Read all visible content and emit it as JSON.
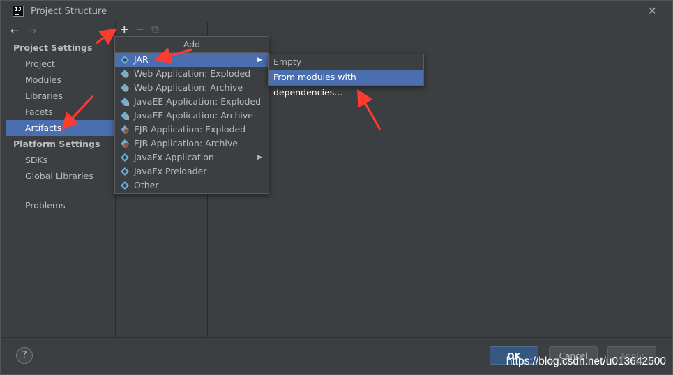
{
  "window": {
    "title": "Project Structure"
  },
  "sidebar": {
    "project_settings": "Project Settings",
    "project_items": [
      "Project",
      "Modules",
      "Libraries",
      "Facets",
      "Artifacts"
    ],
    "platform_settings": "Platform Settings",
    "platform_items": [
      "SDKs",
      "Global Libraries"
    ],
    "problems": "Problems"
  },
  "toolbar": {
    "add": "+",
    "remove": "−",
    "copy": "⧉"
  },
  "add_menu": {
    "header": "Add",
    "items": [
      "JAR",
      "Web Application: Exploded",
      "Web Application: Archive",
      "JavaEE Application: Exploded",
      "JavaEE Application: Archive",
      "EJB Application: Exploded",
      "EJB Application: Archive",
      "JavaFx Application",
      "JavaFx Preloader",
      "Other"
    ]
  },
  "jar_submenu": {
    "items": [
      "Empty",
      "From modules with dependencies..."
    ]
  },
  "buttons": {
    "help": "?",
    "ok": "OK",
    "cancel": "Cancel",
    "apply": "Apply"
  },
  "watermark": "https://blog.csdn.net/u013642500",
  "colors": {
    "selection": "#4b6eaf",
    "annotation_arrow": "#ff3b30",
    "background": "#3c3f41"
  }
}
